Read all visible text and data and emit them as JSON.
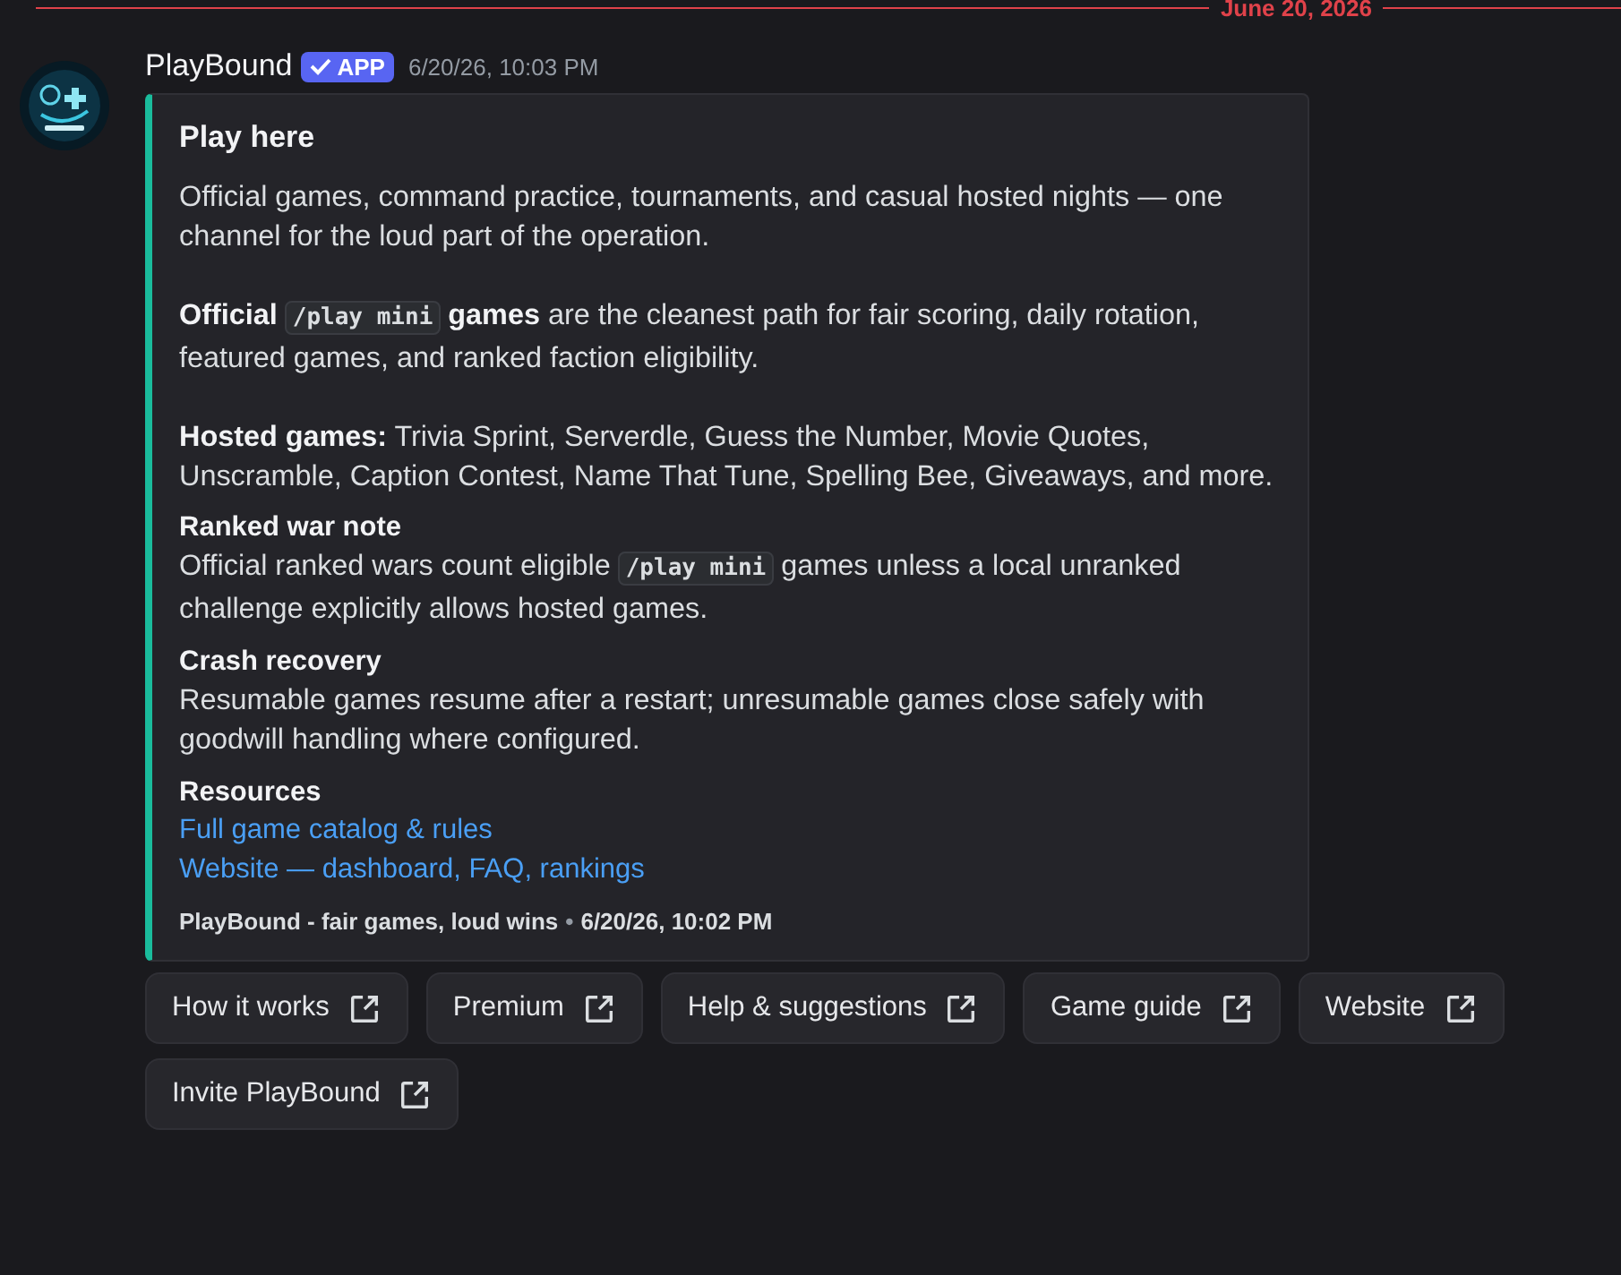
{
  "divider": {
    "date": "June 20, 2026"
  },
  "message": {
    "author": "PlayBound",
    "badge": "APP",
    "verified": true,
    "timestamp": "6/20/26, 10:03 PM"
  },
  "embed": {
    "color": "#1abc9c",
    "title": "Play here",
    "description": [
      [
        {
          "kind": "text",
          "text": "Official games, command practice, tournaments, and casual hosted nights — one channel for the loud part of the operation."
        }
      ],
      [
        {
          "kind": "bold",
          "text": "Official "
        },
        {
          "kind": "code",
          "text": "/play mini"
        },
        {
          "kind": "bold",
          "text": " games"
        },
        {
          "kind": "text",
          "text": " are the cleanest path for fair scoring, daily rotation, featured games, and ranked faction eligibility."
        }
      ],
      [
        {
          "kind": "bold",
          "text": "Hosted games:"
        },
        {
          "kind": "text",
          "text": " Trivia Sprint, Serverdle, Guess the Number, Movie Quotes, Unscramble, Caption Contest, Name That Tune, Spelling Bee, Giveaways, and more."
        }
      ]
    ],
    "fields": [
      {
        "name": "Ranked war note",
        "value": [
          {
            "kind": "text",
            "text": "Official ranked wars count eligible "
          },
          {
            "kind": "code",
            "text": "/play mini"
          },
          {
            "kind": "text",
            "text": " games unless a local unranked challenge explicitly allows hosted games."
          }
        ]
      },
      {
        "name": "Crash recovery",
        "value": [
          {
            "kind": "text",
            "text": "Resumable games resume after a restart; unresumable games close safely with goodwill handling where configured."
          }
        ]
      },
      {
        "name": "Resources",
        "value": [
          {
            "kind": "link",
            "text": "Full game catalog & rules"
          },
          {
            "kind": "break"
          },
          {
            "kind": "link",
            "text": "Website — dashboard, FAQ, rankings"
          }
        ]
      }
    ],
    "footer": {
      "text": "PlayBound - fair games, loud wins",
      "separator": "•",
      "timestamp": "6/20/26, 10:02 PM"
    }
  },
  "buttons": [
    {
      "label": "How it works"
    },
    {
      "label": "Premium"
    },
    {
      "label": "Help & suggestions"
    },
    {
      "label": "Game guide"
    },
    {
      "label": "Website"
    },
    {
      "label": "Invite PlayBound"
    }
  ]
}
